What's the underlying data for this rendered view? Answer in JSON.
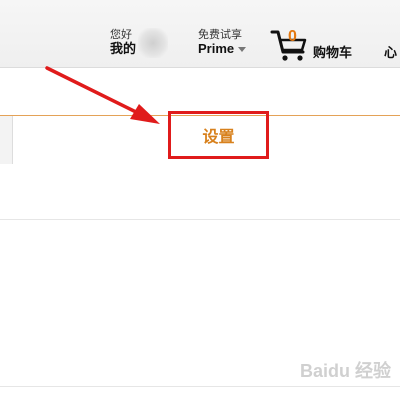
{
  "header": {
    "greeting_small": "您好",
    "greeting_big": "我的",
    "prime_small": "免费试享",
    "prime_big": "Prime",
    "cart_count": "0",
    "cart_label": "购物车",
    "more_label": "心"
  },
  "main": {
    "settings_label": "设置"
  },
  "annotation": {
    "color": "#e01b1b"
  },
  "colors": {
    "accent": "#e47911",
    "settings_text": "#d8811d",
    "highlight_box": "#e01b1b"
  }
}
